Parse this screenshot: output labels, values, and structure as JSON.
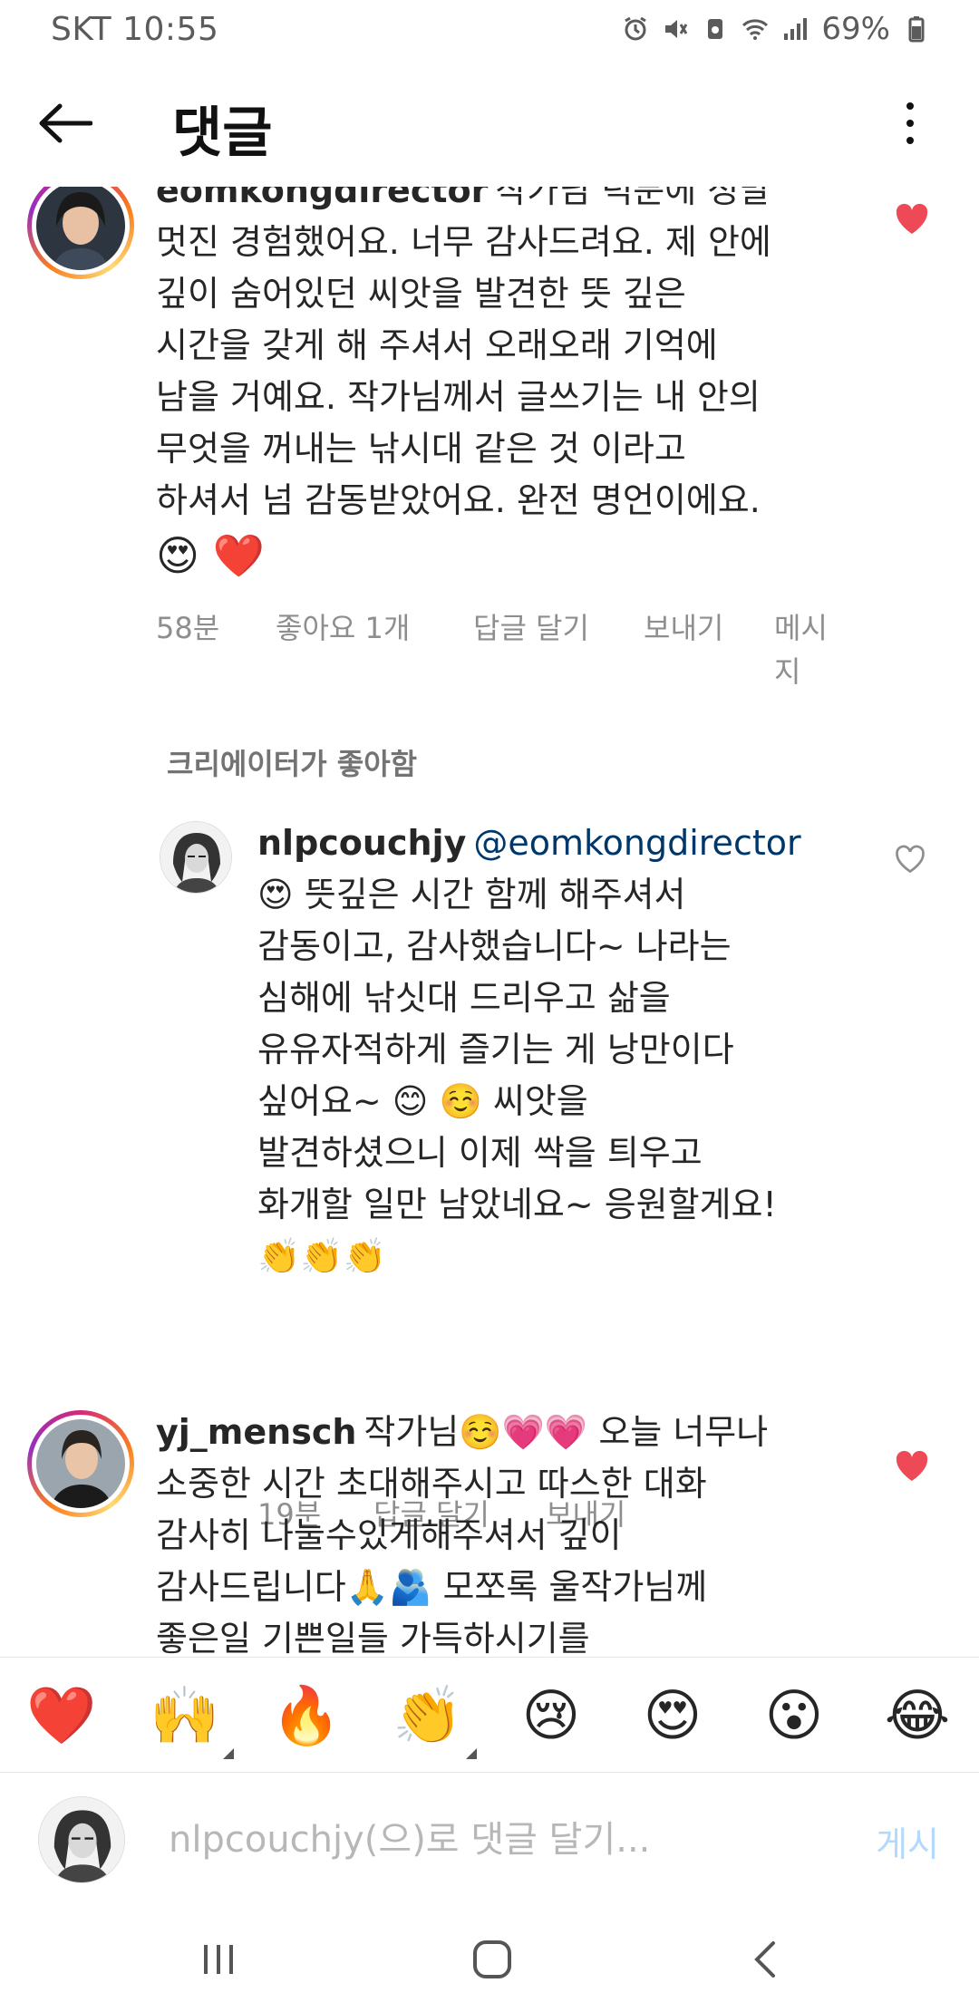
{
  "status_bar": {
    "carrier_time": "SKT 10:55",
    "battery": "69%",
    "icons": [
      "alarm-icon",
      "mute-icon",
      "recycle-icon",
      "wifi-icon",
      "signal-icon",
      "battery-icon"
    ]
  },
  "header": {
    "title": "댓글",
    "back_icon": "arrow-left-icon",
    "more_icon": "more-vertical-icon"
  },
  "comments": [
    {
      "username": "eomkongdirector",
      "text_line1": "작가님 덕분에 정말",
      "lines": [
        "멋진 경험했어요. 너무 감사드려요. 제 안에",
        "깊이 숨어있던 씨앗을 발견한 뜻 깊은",
        "시간을 갖게 해 주셔서 오래오래 기억에",
        "남을 거예요. 작가님께서 글쓰기는 내 안의",
        "무엇을 꺼내는 낚시대 같은 것 이라고",
        "하셔서 넘 감동받았어요. 완전 명언이에요."
      ],
      "emojis": "😍 ❤️",
      "time": "58분",
      "likes": "좋아요 1개",
      "reply": "답글 달기",
      "send": "보내기",
      "message_1": "메시",
      "message_2": "지",
      "liked": true
    },
    {
      "creator_liked": "크리에이터가 좋아함",
      "username": "nlpcouchjy",
      "mention": "@eomkongdirector",
      "lines": [
        "😍 뜻깊은 시간 함께 해주셔서",
        "감동이고, 감사했습니다~  나라는",
        "심해에 낚싯대 드리우고 삶을",
        "유유자적하게 즐기는 게 낭만이다",
        "싶어요~ 😊 ☺️ 씨앗을",
        "발견하셨으니 이제 싹을 틔우고",
        "화개할 일만 남았네요~ 응원할게요!",
        "👏👏👏"
      ],
      "time": "19분",
      "reply": "답글 달기",
      "send": "보내기",
      "liked": false
    },
    {
      "username": "yj_mensch",
      "text_line1": "작가님☺️💗💗 오늘 너무나",
      "lines": [
        "소중한 시간 초대해주시고 따스한 대화",
        "감사히 나눌수있게해주셔서 깊이",
        "감사드립니다🙏🫂 모쪼록 울작가님께",
        "좋은일 기쁜일들 가득하시기를"
      ],
      "liked": true
    }
  ],
  "emoji_bar": {
    "items": [
      "❤️",
      "🙌",
      "🔥",
      "👏",
      "😢",
      "😍",
      "😮",
      "😂"
    ]
  },
  "input_bar": {
    "placeholder": "nlpcouchjy(으)로 댓글 달기...",
    "post_label": "게시"
  },
  "nav_bar": {
    "icons": [
      "recent-apps-icon",
      "home-icon",
      "back-nav-icon"
    ]
  },
  "colors": {
    "like_red": "#ed4956",
    "mention_blue": "#00376b",
    "post_disabled": "#b3d9fc",
    "meta_gray": "#8e8e8e"
  }
}
